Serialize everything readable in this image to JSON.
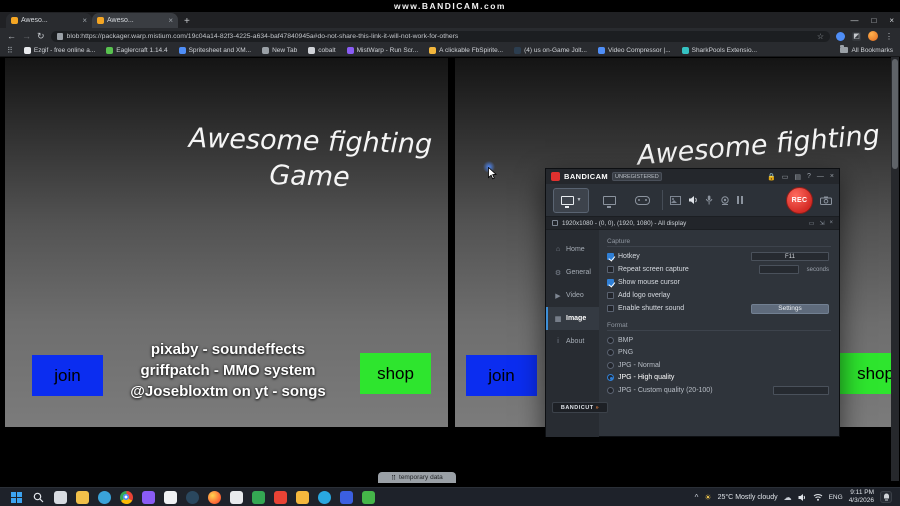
{
  "watermark": "www.BANDICAM.com",
  "colors": {
    "join_blue": "#0b2df0",
    "shop_green": "#2ee52e",
    "rec_red": "#d42b25",
    "accent_blue": "#2f7fd6"
  },
  "browser": {
    "tabs": [
      {
        "label": "Aweso..."
      },
      {
        "label": "Aweso..."
      }
    ],
    "url": "blob:https://packager.warp.mistium.com/19c04a14-82f3-4225-a634-baf47840945a#do-not-share-this-link-it-will-not-work-for-others",
    "bookmarks": [
      "Ezgif - free online a...",
      "Eaglercraft 1.14.4",
      "Spritesheet and XM...",
      "New Tab",
      "cobalt",
      "MistWarp - Run Scr...",
      "A clickable FbSpirite...",
      "(4) us on-Game Jolt...",
      "Video Compressor |...",
      "SharkPools Extensio..."
    ],
    "all_bookmarks_label": "All Bookmarks"
  },
  "game": {
    "title_line1": "Awesome fighting",
    "title_line2": "Game",
    "join": "join",
    "shop": "shop",
    "credits": [
      "pixaby - soundeffects",
      "griffpatch - MMO system",
      "@Josebloxtm on yt - songs"
    ],
    "temp_tab": "temporary data"
  },
  "bandicam": {
    "title": "BANDICAM",
    "unregistered": "UNREGISTERED",
    "rec": "REC",
    "display_info": "1920x1080 - (0, 0), (1920, 1080) - All display",
    "sidebar": [
      "Home",
      "General",
      "Video",
      "Image",
      "About"
    ],
    "active_sidebar": "Image",
    "capture": {
      "heading": "Capture",
      "rows": [
        {
          "label": "Hotkey",
          "checked": true,
          "value": "F11"
        },
        {
          "label": "Repeat screen capture",
          "checked": false,
          "suffix": "seconds"
        },
        {
          "label": "Show mouse cursor",
          "checked": true
        },
        {
          "label": "Add logo overlay",
          "checked": false
        },
        {
          "label": "Enable shutter sound",
          "checked": false,
          "button": "Settings"
        }
      ]
    },
    "format": {
      "heading": "Format",
      "options": [
        "BMP",
        "PNG",
        "JPG - Normal",
        "JPG - High quality",
        "JPG - Custom quality (20-100)"
      ],
      "selected": "JPG - High quality"
    },
    "bandicut": "BANDICUT",
    "bandicut_arrow": "»"
  },
  "taskbar": {
    "icons": [
      "start",
      "search",
      "copilot",
      "file-explorer",
      "edge",
      "chrome",
      "discord",
      "obs",
      "steam",
      "firefox",
      "notepad",
      "sheets",
      "gmail",
      "photos",
      "telegram",
      "drive",
      "excel"
    ],
    "weather": {
      "temp": "25°C",
      "desc": "Mostly cloudy"
    },
    "lang": "ENG",
    "time": "9:11 PM",
    "date": "4/3/2026"
  }
}
